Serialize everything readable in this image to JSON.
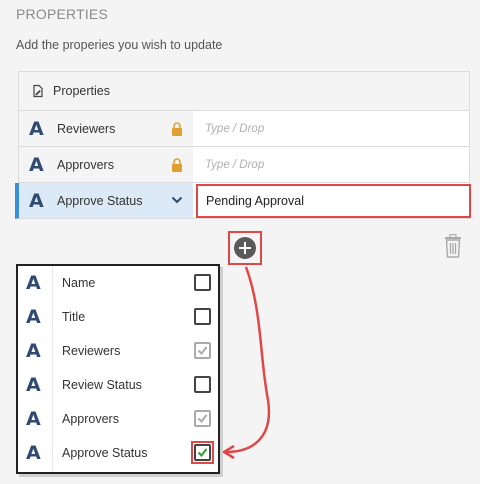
{
  "section": {
    "title": "PROPERTIES",
    "description": "Add the properies you wish to update"
  },
  "table": {
    "header_icon": "document-edit-icon",
    "header_label": "Properties",
    "rows": [
      {
        "type_icon": "A",
        "label": "Reviewers",
        "value": "",
        "placeholder": "Type / Drop",
        "status_icon": "lock-icon"
      },
      {
        "type_icon": "A",
        "label": "Approvers",
        "value": "",
        "placeholder": "Type / Drop",
        "status_icon": "lock-icon"
      },
      {
        "type_icon": "A",
        "label": "Approve Status",
        "value": "Pending Approval",
        "placeholder": "",
        "status_icon": "chevron-down-icon",
        "selected": true
      }
    ]
  },
  "actions": {
    "add_icon": "plus-circle-icon",
    "delete_icon": "trash-icon"
  },
  "dropdown": {
    "items": [
      {
        "type_icon": "A",
        "label": "Name",
        "checked": false
      },
      {
        "type_icon": "A",
        "label": "Title",
        "checked": false
      },
      {
        "type_icon": "A",
        "label": "Reviewers",
        "checked": true,
        "disabled": true
      },
      {
        "type_icon": "A",
        "label": "Review Status",
        "checked": false
      },
      {
        "type_icon": "A",
        "label": "Approvers",
        "checked": true,
        "disabled": true
      },
      {
        "type_icon": "A",
        "label": "Approve Status",
        "checked": true,
        "highlighted": true
      }
    ]
  },
  "colors": {
    "accent_blue": "#3a8fd9",
    "highlight_red": "#e04848",
    "type_icon": "#2f4a73",
    "lock": "#e0a030",
    "check_green": "#3aa03a"
  }
}
